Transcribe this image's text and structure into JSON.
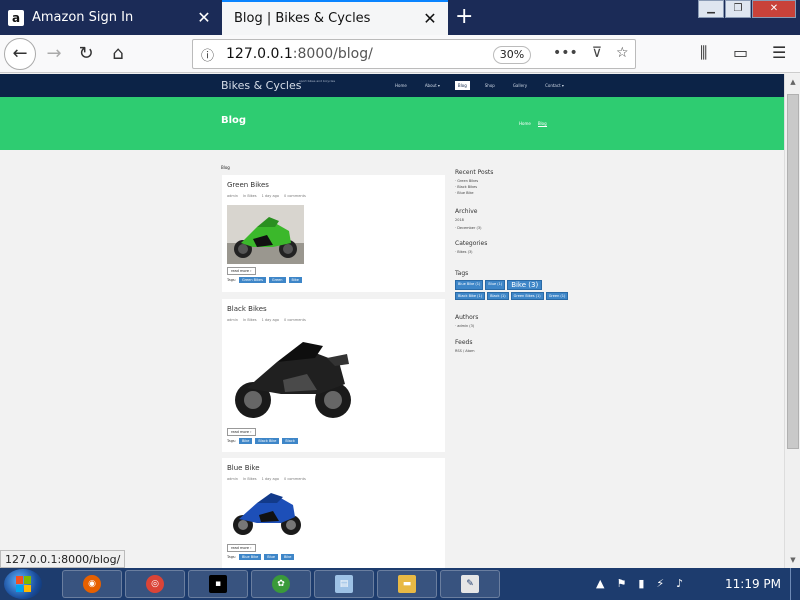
{
  "browser": {
    "tabs": [
      {
        "title": "Amazon Sign In",
        "favicon": "amazon-icon",
        "active": false
      },
      {
        "title": "Blog | Bikes & Cycles",
        "favicon": "page-icon",
        "active": true
      }
    ],
    "url_host": "127.0.0.1",
    "url_rest": ":8000/blog/",
    "zoom": "30%",
    "status_url": "127.0.0.1:8000/blog/"
  },
  "site": {
    "brand": "Bikes & Cycles",
    "tagline": "sport bikes and bicycles",
    "menu": [
      "Home",
      "About ▾",
      "Blog",
      "Shop",
      "Gallery",
      "Contact ▾"
    ],
    "active_menu": "Blog",
    "hero_title": "Blog",
    "breadcrumbs": [
      "Home",
      "Blog"
    ],
    "small_heading": "Blog"
  },
  "posts": [
    {
      "title": "Green Bikes",
      "meta": [
        "admin",
        "In Bikes",
        "1 day ago",
        "0 comments"
      ],
      "image": "green-motorcycle",
      "read_more": "read more ›",
      "tags_label": "Tags:",
      "tags": [
        "Green Bikes",
        "Green",
        "Bike"
      ]
    },
    {
      "title": "Black Bikes",
      "meta": [
        "admin",
        "In Bikes",
        "1 day ago",
        "0 comments"
      ],
      "image": "black-motorcycle",
      "read_more": "read more ›",
      "tags_label": "Tags:",
      "tags": [
        "Bike",
        "Black Bike",
        "Black"
      ]
    },
    {
      "title": "Blue Bike",
      "meta": [
        "admin",
        "In Bikes",
        "1 day ago",
        "0 comments"
      ],
      "image": "blue-motorcycle",
      "read_more": "read more ›",
      "tags_label": "Tags:",
      "tags": [
        "Blue Bike",
        "Blue",
        "Bike"
      ]
    }
  ],
  "sidebar": {
    "recent_title": "Recent Posts",
    "recent": [
      "· Green Bikes",
      "· Black Bikes",
      "· Blue Bike"
    ],
    "archive_title": "Archive",
    "archive_year": "2018",
    "archive_month": "· December (3)",
    "categories_title": "Categories",
    "categories": [
      "· Bikes (3)"
    ],
    "tags_title": "Tags",
    "tags": [
      "Blue Bike (1)",
      "Blue (1)",
      "Bike (3)",
      "Black Bike (1)",
      "Black (1)",
      "Green Bikes (1)",
      "Green (1)"
    ],
    "authors_title": "Authors",
    "authors": [
      "· admin (3)"
    ],
    "feeds_title": "Feeds",
    "feeds": "RSS / Atom"
  },
  "taskbar": {
    "clock": "11:19 PM"
  },
  "colors": {
    "header_navy": "#0c2347",
    "hero_green": "#2ecc71",
    "tag_blue": "#3e86c8",
    "taskbar": "#1d3c6e"
  }
}
